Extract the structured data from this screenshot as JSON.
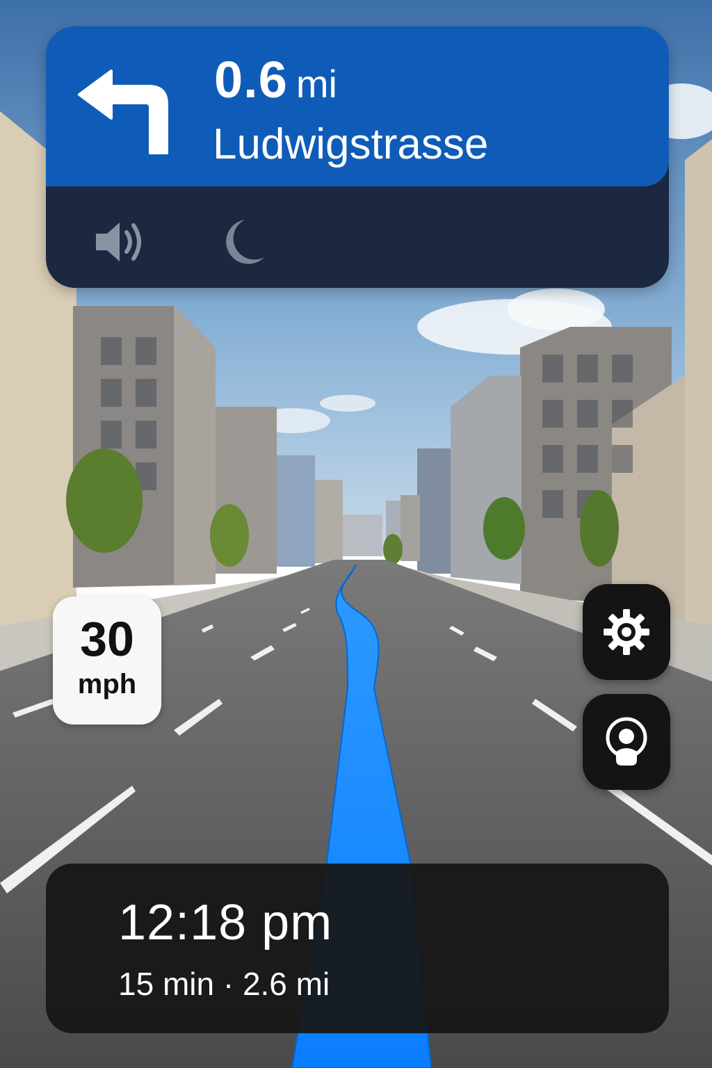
{
  "maneuver": {
    "icon": "turn-left-icon",
    "distance_value": "0.6",
    "distance_unit": "mi",
    "street": "Ludwigstrasse"
  },
  "toolbar": {
    "sound_icon": "speaker-icon",
    "night_icon": "moon-icon"
  },
  "speed_limit": {
    "value": "30",
    "unit": "mph"
  },
  "controls": {
    "settings_icon": "gear-icon",
    "recenter_icon": "location-pin-icon"
  },
  "trip": {
    "arrival_time": "12:18 pm",
    "details": "15 min · 2.6 mi"
  },
  "colors": {
    "banner_blue": "#0f5cb8",
    "banner_dark": "#1c2840",
    "route_blue": "#1a8cff",
    "panel_dark": "#161616"
  }
}
